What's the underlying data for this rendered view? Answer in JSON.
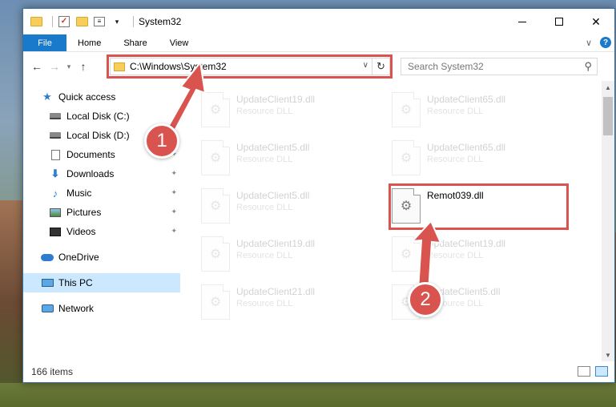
{
  "window": {
    "title": "System32"
  },
  "ribbon": {
    "file_tab": "File",
    "tabs": [
      "Home",
      "Share",
      "View"
    ]
  },
  "address": {
    "path": "C:\\Windows\\System32",
    "search_placeholder": "Search System32"
  },
  "sidebar": {
    "items": [
      {
        "label": "Quick access",
        "icon": "star-icon"
      },
      {
        "label": "Local Disk (C:)",
        "icon": "drive-icon"
      },
      {
        "label": "Local Disk (D:)",
        "icon": "drive-icon"
      },
      {
        "label": "Documents",
        "icon": "document-icon"
      },
      {
        "label": "Downloads",
        "icon": "download-icon"
      },
      {
        "label": "Music",
        "icon": "music-icon"
      },
      {
        "label": "Pictures",
        "icon": "pictures-icon"
      },
      {
        "label": "Videos",
        "icon": "video-icon"
      },
      {
        "label": "OneDrive",
        "icon": "cloud-icon"
      },
      {
        "label": "This PC",
        "icon": "computer-icon"
      },
      {
        "label": "Network",
        "icon": "network-icon"
      }
    ]
  },
  "files": {
    "left": [
      {
        "name": "UpdateClient19.dll",
        "type": "Resource DLL"
      },
      {
        "name": "UpdateClient5.dll",
        "type": "Resource DLL"
      },
      {
        "name": "UpdateClient5.dll",
        "type": "Resource DLL"
      },
      {
        "name": "UpdateClient19.dll",
        "type": "Resource DLL"
      },
      {
        "name": "UpdateClient21.dll",
        "type": "Resource DLL"
      }
    ],
    "right": [
      {
        "name": "UpdateClient65.dll",
        "type": "Resource DLL"
      },
      {
        "name": "UpdateClient65.dll",
        "type": "Resource DLL"
      },
      {
        "name": "Remot039.dll",
        "type": ""
      },
      {
        "name": "UpdateClient19.dll",
        "type": "Resource DLL"
      },
      {
        "name": "UpdateClient5.dll",
        "type": "Resource DLL"
      }
    ]
  },
  "status": {
    "item_count": "166 items"
  },
  "annotations": {
    "step1": "1",
    "step2": "2",
    "color": "#d9534f"
  }
}
